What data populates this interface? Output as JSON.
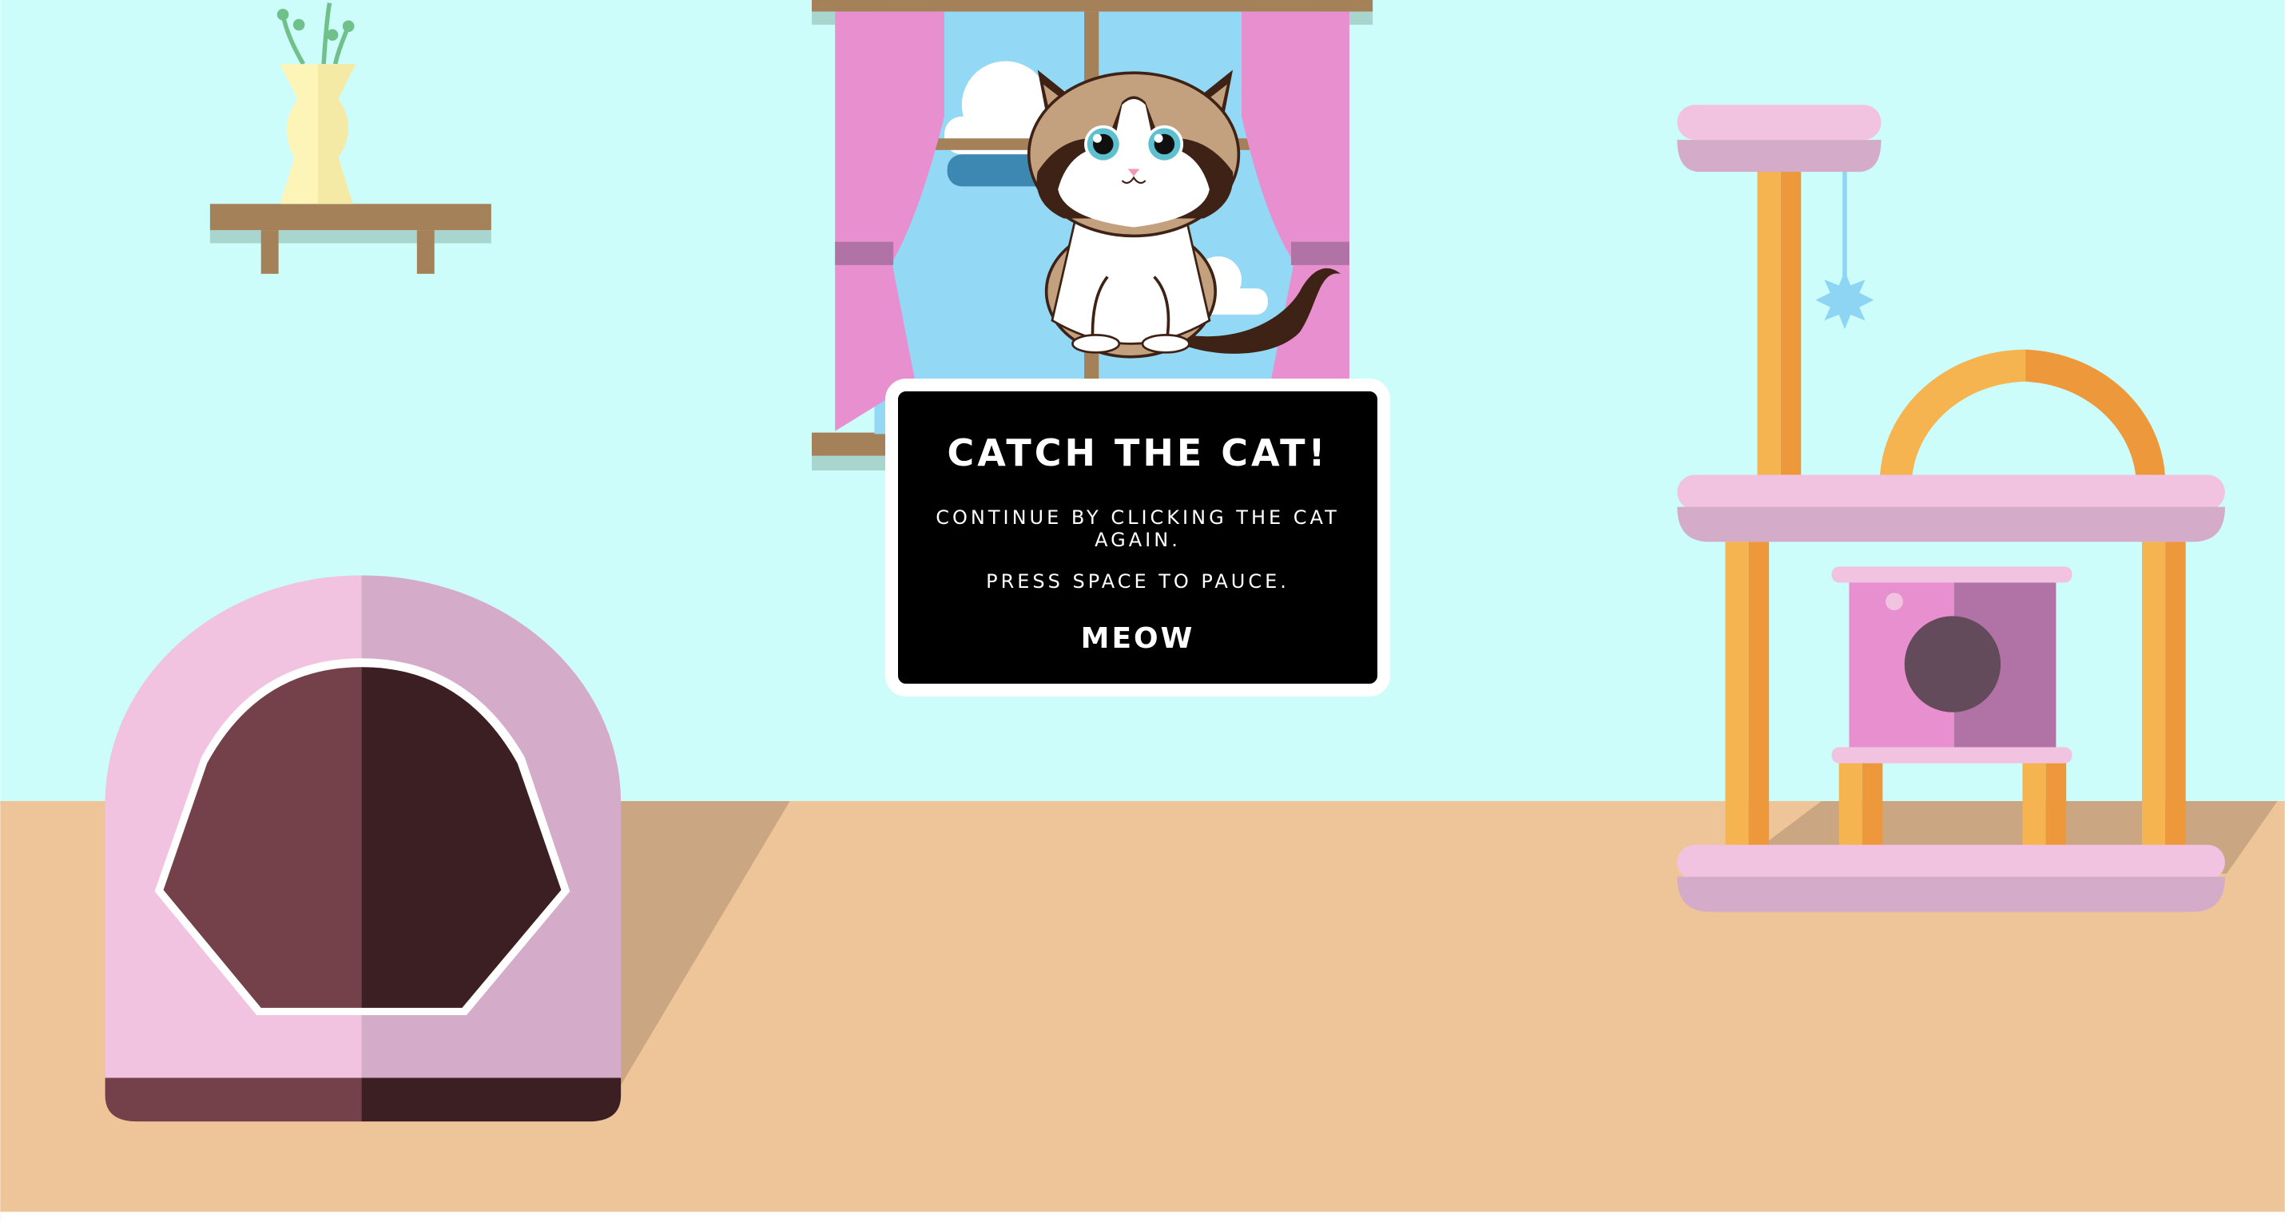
{
  "modal": {
    "title": "CATCH THE CAT!",
    "line1": "CONTINUE BY CLICKING THE CAT AGAIN.",
    "line2": "PRESS SPACE TO PAUCE.",
    "action": "MEOW"
  },
  "colors": {
    "wall": "#cdfdfb",
    "floor": "#eec598",
    "floor_shadow": "#cba683",
    "curtain": "#e88fd0",
    "sky": "#93d8f4",
    "wood": "#a5815a",
    "modal_bg": "#000000",
    "modal_text": "#ffffff"
  },
  "icons": {
    "cat": "cat-icon",
    "toy": "spiky-ball-icon",
    "plant": "plant-vase-icon"
  }
}
